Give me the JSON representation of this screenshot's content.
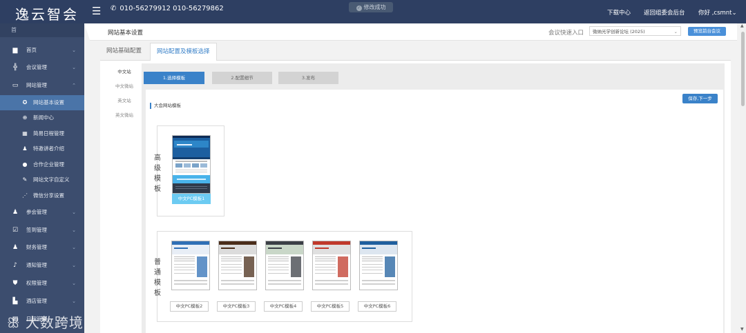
{
  "header": {
    "logo": "逸云智会",
    "phone": "010-56279912  010-56279862",
    "toast": "修改成功",
    "links": [
      "下载中心",
      "返回组委会后台",
      "你好 ,csmnt"
    ]
  },
  "sidebar": {
    "head": "首",
    "items": [
      {
        "label": "首页",
        "icon": "file-icon",
        "glyph": "▆",
        "chev": "⌄"
      },
      {
        "label": "会议管理",
        "icon": "meeting-icon",
        "glyph": "╬",
        "chev": "⌄"
      },
      {
        "label": "网站管理",
        "icon": "monitor-icon",
        "glyph": "▭",
        "chev": "⌃"
      },
      {
        "label": "网站基本设置",
        "icon": "settings-icon",
        "glyph": "✪",
        "sub": true,
        "active": true
      },
      {
        "label": "新闻中心",
        "icon": "globe-icon",
        "glyph": "⊕",
        "sub": true
      },
      {
        "label": "简易日程管理",
        "icon": "calendar-icon",
        "glyph": "▦",
        "sub": true
      },
      {
        "label": "特邀讲者介绍",
        "icon": "speaker-icon",
        "glyph": "♟",
        "sub": true
      },
      {
        "label": "合作企业管理",
        "icon": "info-icon",
        "glyph": "●",
        "sub": true
      },
      {
        "label": "网站文字自定义",
        "icon": "text-icon",
        "glyph": "✎",
        "sub": true
      },
      {
        "label": "微信分享设置",
        "icon": "share-icon",
        "glyph": "⋰",
        "sub": true
      },
      {
        "label": "参会管理",
        "icon": "user-icon",
        "glyph": "♟",
        "chev": "⌄"
      },
      {
        "label": "签到管理",
        "icon": "checkin-icon",
        "glyph": "☑",
        "chev": "⌄"
      },
      {
        "label": "财务管理",
        "icon": "finance-icon",
        "glyph": "♟",
        "chev": "⌄"
      },
      {
        "label": "通知管理",
        "icon": "bell-icon",
        "glyph": "♪",
        "chev": "⌄"
      },
      {
        "label": "权限管理",
        "icon": "shield-icon",
        "glyph": "⛊",
        "chev": "⌄"
      },
      {
        "label": "酒店管理",
        "icon": "hotel-icon",
        "glyph": "▙",
        "chev": "⌄"
      },
      {
        "label": "日程管理",
        "icon": "schedule-icon",
        "glyph": "▤",
        "chev": "⌄"
      }
    ]
  },
  "main": {
    "title": "网站基本设置",
    "quick_label": "会议快速入口",
    "quick_value": "微纳光学创新论坛 (2025)",
    "preview_btn": "预览前台会议",
    "tabs": [
      "网站基础配置",
      "网站配置及模板选择"
    ],
    "site_tabs": [
      "中文站",
      "中文微站",
      "英文站",
      "英文微站"
    ],
    "steps": [
      "1.选择模板",
      "2.配置细节",
      "3.发布"
    ],
    "save_btn": "保存,下一步",
    "section_label": "大会网站模板",
    "advanced_label": [
      "高",
      "级",
      "模",
      "板"
    ],
    "advanced_templates": [
      "中文PC模板1"
    ],
    "normal_label": [
      "普",
      "通",
      "模",
      "板"
    ],
    "normal_templates": [
      "中文PC模板2",
      "中文PC模板3",
      "中文PC模板4",
      "中文PC模板5",
      "中文PC模板6"
    ]
  },
  "watermark": "大数跨境",
  "colors": {
    "topbar": "#2e3f62",
    "sidebar": "#3c4d6e",
    "accent": "#3a82c9",
    "active_nav": "#4a74a8"
  }
}
